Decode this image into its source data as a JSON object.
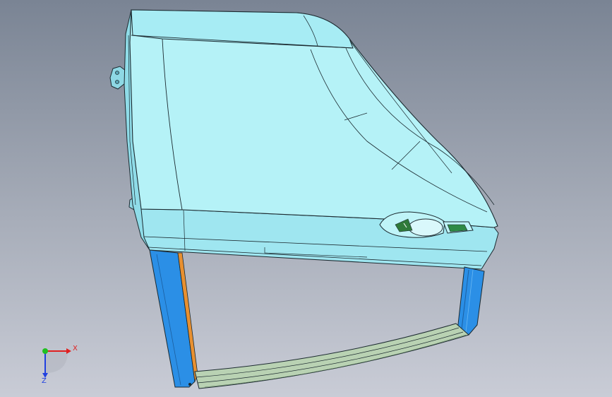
{
  "triad": {
    "x_label": "X",
    "z_label": "Z",
    "x_color": "#e02020",
    "y_color": "#20c020",
    "z_color": "#2040e0"
  },
  "model": {
    "body_color": "#a8ecf4",
    "top_color": "#b5f2f7",
    "edge_color": "#1c2a30",
    "leg_color": "#2b8fe6",
    "leg_accent_color": "#e89030",
    "rail_color": "#b9d2b3"
  }
}
